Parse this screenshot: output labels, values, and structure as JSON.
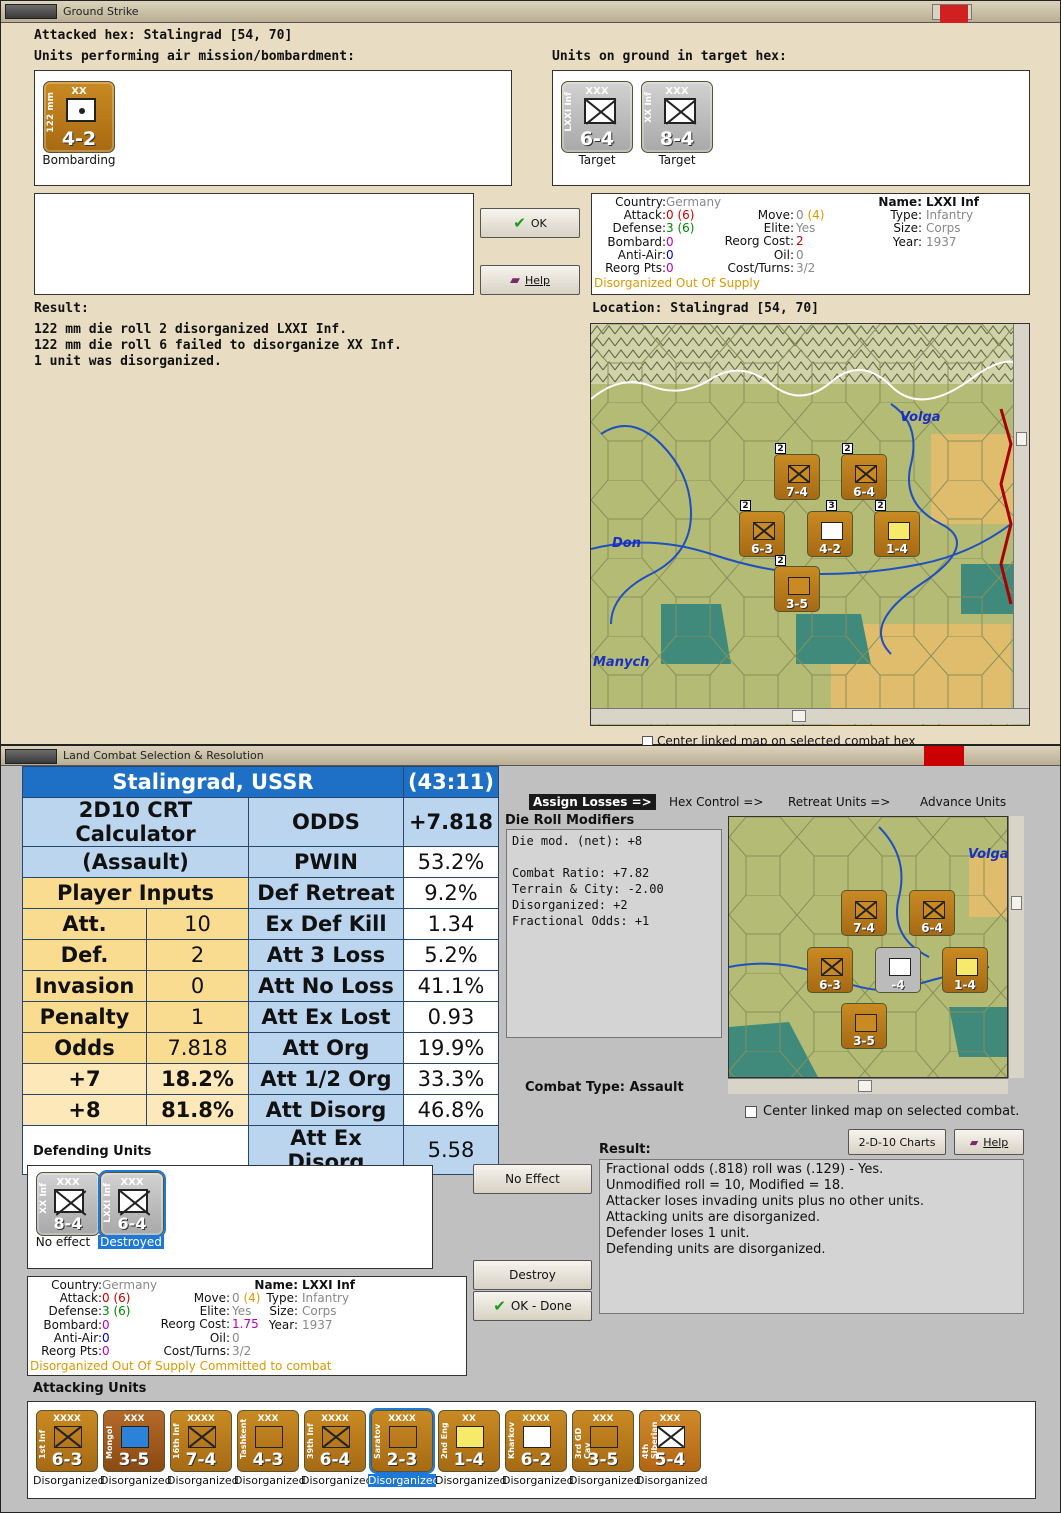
{
  "window1": {
    "title": "Ground Strike",
    "attacked_hex": "Attacked hex: Stalingrad  [54, 70]",
    "air_units_label": "Units performing air mission/bombardment:",
    "ground_units_label": "Units on ground in target hex:",
    "air_unit": {
      "side": "122 mm",
      "size": "XX",
      "strength": "4-2",
      "caption": "Bombarding"
    },
    "targets": [
      {
        "side": "LXXI Inf",
        "size": "XXX",
        "strength": "6-4",
        "caption": "Target"
      },
      {
        "side": "XX Inf",
        "size": "XXX",
        "strength": "8-4",
        "caption": "Target"
      }
    ],
    "ok_label": "OK",
    "help_label": "Help",
    "info": {
      "country_label": "Country:",
      "country": "Germany",
      "name_label": "Name:",
      "name": "LXXI Inf",
      "attack_label": "Attack:",
      "attack": "0",
      "attack_paren": "(6)",
      "defense_label": "Defense:",
      "defense": "3",
      "defense_paren": "(6)",
      "bombard_label": "Bombard:",
      "bombard": "0",
      "antiair_label": "Anti-Air:",
      "antiair": "0",
      "reorgpts_label": "Reorg Pts:",
      "reorgpts": "0",
      "move_label": "Move:",
      "move": "0",
      "move_paren": "(4)",
      "elite_label": "Elite:",
      "elite": "Yes",
      "reorgcost_label": "Reorg Cost:",
      "reorgcost": "2",
      "oil_label": "Oil:",
      "oil": "0",
      "costturns_label": "Cost/Turns:",
      "costturns": "3/2",
      "type_label": "Type:",
      "type": "Infantry",
      "size_label": "Size:",
      "size": "Corps",
      "year_label": "Year:",
      "year": "1937",
      "status": "Disorganized Out Of Supply"
    },
    "result_label": "Result:",
    "result_lines": [
      "122 mm die roll 2 disorganized LXXI Inf.",
      "122 mm die roll 6 failed to disorganize XX Inf.",
      "1 unit was disorganized."
    ],
    "location": "Location:  Stalingrad  [54, 70]",
    "map_labels": {
      "volga": "Volga",
      "don": "Don",
      "manych": "Manych"
    },
    "map_units": [
      {
        "label": "7-4",
        "badge": "2"
      },
      {
        "label": "6-4",
        "badge": "2"
      },
      {
        "label": "6-3",
        "badge": "2"
      },
      {
        "label": "4-2",
        "badge": "3"
      },
      {
        "label": "1-4",
        "badge": "2"
      },
      {
        "label": "3-5",
        "badge": "2"
      }
    ],
    "center_linked": "Center linked map on selected combat hex"
  },
  "window2": {
    "title": "Land Combat Selection & Resolution",
    "crt": {
      "location": "Stalingrad, USSR",
      "ratio": "(43:11)",
      "calc_title": "2D10 CRT Calculator",
      "calc_sub": "(Assault)",
      "player_inputs": "Player Inputs",
      "rows_left": [
        {
          "label": "Att.",
          "value": "10"
        },
        {
          "label": "Def.",
          "value": "2"
        },
        {
          "label": "Invasion",
          "value": "0"
        },
        {
          "label": "Penalty",
          "value": "1"
        },
        {
          "label": "Odds",
          "value": "7.818"
        },
        {
          "label": "+7",
          "value": "18.2%"
        },
        {
          "label": "+8",
          "value": "81.8%"
        }
      ],
      "rows_right": [
        {
          "label": "ODDS",
          "value": "+7.818"
        },
        {
          "label": "PWIN",
          "value": "53.2%"
        },
        {
          "label": "Def Retreat",
          "value": "9.2%"
        },
        {
          "label": "Ex Def Kill",
          "value": "1.34"
        },
        {
          "label": "Att 3 Loss",
          "value": "5.2%"
        },
        {
          "label": "Att No Loss",
          "value": "41.1%"
        },
        {
          "label": "Att Ex Lost",
          "value": "0.93"
        },
        {
          "label": "Att Org",
          "value": "19.9%"
        },
        {
          "label": "Att 1/2 Org",
          "value": "33.3%"
        },
        {
          "label": "Att Disorg",
          "value": "46.8%"
        },
        {
          "label": "Att Ex Disorg",
          "value": "5.58"
        }
      ]
    },
    "tabs": [
      "Assign Losses =>",
      "Hex Control =>",
      "Retreat Units =>",
      "Advance Units"
    ],
    "die_roll_title": "Die Roll Modifiers",
    "die_roll_lines": [
      "Die mod. (net): +8",
      "",
      "Combat Ratio: +7.82",
      "Terrain & City: -2.00",
      "Disorganized: +2",
      "Fractional Odds: +1"
    ],
    "combat_type": "Combat Type:  Assault",
    "center_linked": "Center linked map on selected combat.",
    "charts_label": "2-D-10 Charts",
    "help_label": "Help",
    "defending_label": "Defending Units",
    "defenders": [
      {
        "side": "XX Inf",
        "size": "XXX",
        "strength": "8-4",
        "caption": "No effect"
      },
      {
        "side": "LXXI Inf",
        "size": "XXX",
        "strength": "6-4",
        "caption": "Destroyed"
      }
    ],
    "no_effect_btn": "No Effect",
    "destroy_btn": "Destroy",
    "ok_done_btn": "OK - Done",
    "result_label": "Result:",
    "result_lines": [
      "Fractional odds (.818) roll was (.129)  - Yes.",
      "Unmodified roll = 10, Modified = 18.",
      "Attacker loses invading units plus no other units.",
      "Attacking units are disorganized.",
      "Defender loses 1 unit.",
      "Defending units are disorganized."
    ],
    "info": {
      "country_label": "Country:",
      "country": "Germany",
      "name_label": "Name:",
      "name": "LXXI Inf",
      "attack_label": "Attack:",
      "attack": "0",
      "attack_paren": "(6)",
      "defense_label": "Defense:",
      "defense": "3",
      "defense_paren": "(6)",
      "bombard_label": "Bombard:",
      "bombard": "0",
      "antiair_label": "Anti-Air:",
      "antiair": "0",
      "reorgpts_label": "Reorg Pts:",
      "reorgpts": "0",
      "move_label": "Move:",
      "move": "0",
      "move_paren": "(4)",
      "elite_label": "Elite:",
      "elite": "Yes",
      "reorgcost_label": "Reorg Cost:",
      "reorgcost": "1.75",
      "oil_label": "Oil:",
      "oil": "0",
      "costturns_label": "Cost/Turns:",
      "costturns": "3/2",
      "type_label": "Type:",
      "type": "Infantry",
      "size_label": "Size:",
      "size": "Corps",
      "year_label": "Year:",
      "year": "1937",
      "status": "Disorganized Out Of Supply Committed to combat"
    },
    "map_labels": {
      "volga": "Volga"
    },
    "map_units": [
      {
        "label": "7-4"
      },
      {
        "label": "6-4"
      },
      {
        "label": "6-3"
      },
      {
        "label": "-4"
      },
      {
        "label": "1-4"
      },
      {
        "label": "3-5"
      }
    ],
    "attacking_label": "Attacking Units",
    "attackers": [
      {
        "name": "1st Inf",
        "size": "XXXX",
        "strength": "6-3",
        "caption": "Disorganized"
      },
      {
        "name": "Mongol",
        "size": "XXX",
        "strength": "3-5",
        "caption": "Disorganized"
      },
      {
        "name": "16th Inf",
        "size": "XXXX",
        "strength": "7-4",
        "caption": "Disorganized"
      },
      {
        "name": "Tashkent",
        "size": "XXX",
        "strength": "4-3",
        "caption": "Disorganized"
      },
      {
        "name": "39th Inf",
        "size": "XXXX",
        "strength": "6-4",
        "caption": "Disorganized"
      },
      {
        "name": "Saratov",
        "size": "XXXX",
        "strength": "2-3",
        "caption": "Disorganized"
      },
      {
        "name": "2nd Eng",
        "size": "XX",
        "strength": "1-4",
        "caption": "Disorganized"
      },
      {
        "name": "Kharkov",
        "size": "XXXX",
        "strength": "6-2",
        "caption": "Disorganized"
      },
      {
        "name": "3rd GD Cav",
        "size": "XXX",
        "strength": "3-5",
        "caption": "Disorganized"
      },
      {
        "name": "4th Siberian",
        "size": "XXX",
        "strength": "5-4",
        "caption": "Disorganized"
      }
    ]
  }
}
